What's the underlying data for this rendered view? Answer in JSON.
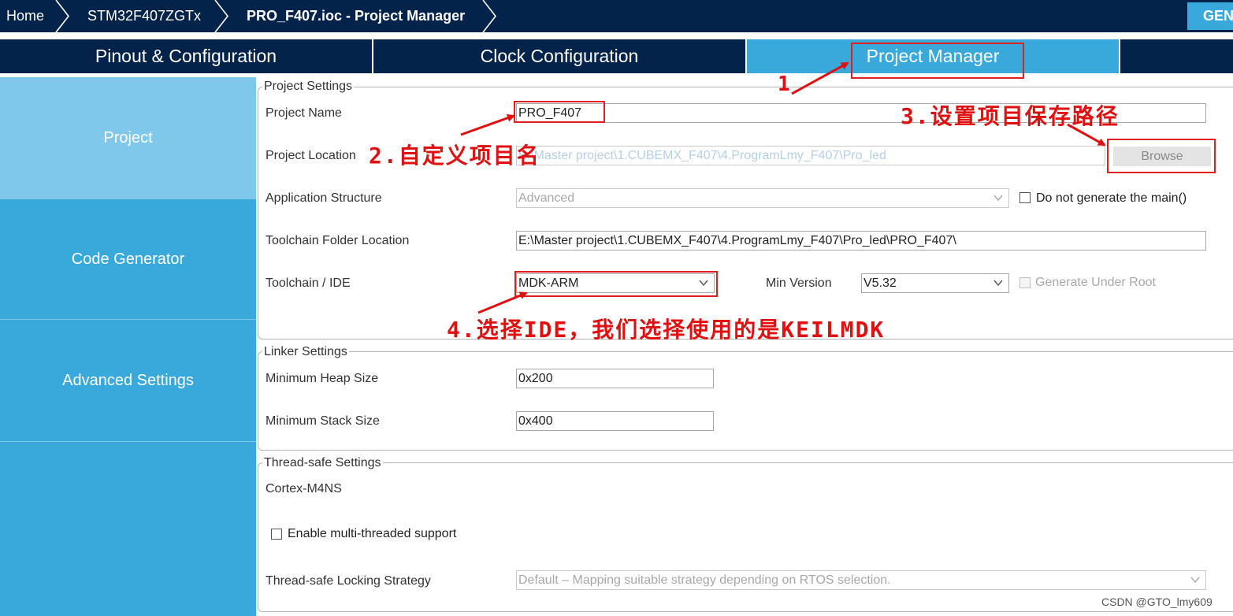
{
  "breadcrumb": {
    "items": [
      "Home",
      "STM32F407ZGTx",
      "PRO_F407.ioc - Project Manager"
    ],
    "generate_label": "GEN"
  },
  "tabs": [
    {
      "label": "Pinout & Configuration",
      "active": false
    },
    {
      "label": "Clock Configuration",
      "active": false
    },
    {
      "label": "Project Manager",
      "active": true
    }
  ],
  "sidebar": {
    "items": [
      {
        "label": "Project",
        "active": true
      },
      {
        "label": "Code Generator",
        "active": false
      },
      {
        "label": "Advanced Settings",
        "active": false
      }
    ]
  },
  "project_settings": {
    "legend": "Project Settings",
    "project_name_label": "Project Name",
    "project_name_value": "PRO_F407",
    "project_location_label": "Project Location",
    "project_location_value": "E:\\Master project\\1.CUBEMX_F407\\4.ProgramLmy_F407\\Pro_led",
    "browse_label": "Browse",
    "app_structure_label": "Application Structure",
    "app_structure_value": "Advanced",
    "no_main_label": "Do not generate the main()",
    "toolchain_folder_label": "Toolchain Folder Location",
    "toolchain_folder_value": "E:\\Master project\\1.CUBEMX_F407\\4.ProgramLmy_F407\\Pro_led\\PRO_F407\\",
    "toolchain_ide_label": "Toolchain / IDE",
    "toolchain_ide_value": "MDK-ARM",
    "min_version_label": "Min Version",
    "min_version_value": "V5.32",
    "generate_under_root_label": "Generate Under Root"
  },
  "linker_settings": {
    "legend": "Linker Settings",
    "heap_label": "Minimum Heap Size",
    "heap_value": "0x200",
    "stack_label": "Minimum Stack Size",
    "stack_value": "0x400"
  },
  "thread_safe_settings": {
    "legend": "Thread-safe Settings",
    "core_label": "Cortex-M4NS",
    "multithread_label": "Enable multi-threaded support",
    "locking_label": "Thread-safe Locking Strategy",
    "locking_value": "Default  –  Mapping suitable strategy depending on RTOS selection."
  },
  "annotations": {
    "step1": "1",
    "step2": "2.自定义项目名",
    "step3": "3.设置项目保存路径",
    "step4": "4.选择IDE，我们选择使用的是KEILMDK",
    "color": "#e01010"
  },
  "watermark": "CSDN @GTO_lmy609",
  "colors": {
    "navy": "#03234b",
    "accent_blue": "#39a9dc",
    "active_light_blue": "#7fc8ec"
  }
}
